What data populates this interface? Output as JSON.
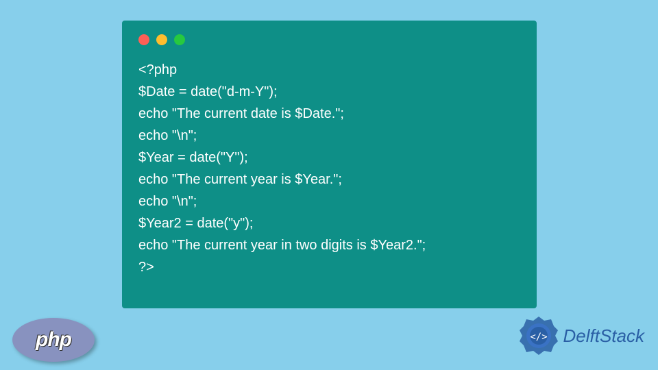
{
  "code": {
    "lines": [
      "<?php",
      "$Date = date(\"d-m-Y\");",
      "echo \"The current date is $Date.\";",
      "echo \"\\n\";",
      "$Year = date(\"Y\");",
      "echo \"The current year is $Year.\";",
      "echo \"\\n\";",
      "$Year2 = date(\"y\");",
      "echo \"The current year in two digits is $Year2.\";",
      "?>"
    ]
  },
  "logos": {
    "php": "php",
    "delftstack": "DelftStack"
  },
  "colors": {
    "background": "#87cfeb",
    "codeWindow": "#0e8f87",
    "phpLogo": "#8892bf",
    "delftstackBlue": "#2a5fa5"
  }
}
